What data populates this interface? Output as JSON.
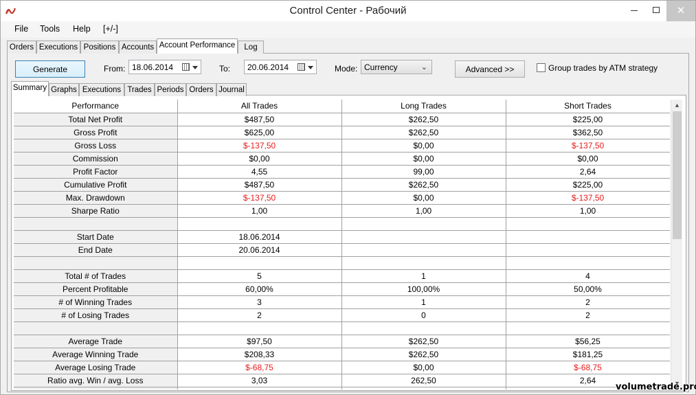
{
  "window": {
    "title": "Control Center - Рабочий",
    "close_glyph": "✕",
    "accent_close": "#c7c7c7"
  },
  "menu": [
    "File",
    "Tools",
    "Help",
    "[+/-]"
  ],
  "top_tabs": [
    "Orders",
    "Executions",
    "Positions",
    "Accounts",
    "Account Performance",
    "Log"
  ],
  "top_tabs_active": "Account Performance",
  "toolbar": {
    "generate_label": "Generate",
    "from_label": "From:",
    "from_value": "18.06.2014",
    "to_label": "To:",
    "to_value": "20.06.2014",
    "mode_label": "Mode:",
    "mode_value": "Currency",
    "advanced_label": "Advanced >>",
    "group_label": "Group trades by ATM strategy",
    "group_checked": false
  },
  "inner_tabs": [
    "Summary",
    "Graphs",
    "Executions",
    "Trades",
    "Periods",
    "Orders",
    "Journal"
  ],
  "inner_tabs_active": "Summary",
  "table": {
    "headers": [
      "Performance",
      "All Trades",
      "Long Trades",
      "Short Trades"
    ],
    "rows": [
      {
        "label": "Total Net Profit",
        "all": "$487,50",
        "long": "$262,50",
        "short": "$225,00"
      },
      {
        "label": "Gross Profit",
        "all": "$625,00",
        "long": "$262,50",
        "short": "$362,50"
      },
      {
        "label": "Gross Loss",
        "all": "$-137,50",
        "long": "$0,00",
        "short": "$-137,50"
      },
      {
        "label": "Commission",
        "all": "$0,00",
        "long": "$0,00",
        "short": "$0,00"
      },
      {
        "label": "Profit Factor",
        "all": "4,55",
        "long": "99,00",
        "short": "2,64"
      },
      {
        "label": "Cumulative Profit",
        "all": "$487,50",
        "long": "$262,50",
        "short": "$225,00"
      },
      {
        "label": "Max. Drawdown",
        "all": "$-137,50",
        "long": "$0,00",
        "short": "$-137,50"
      },
      {
        "label": "Sharpe Ratio",
        "all": "1,00",
        "long": "1,00",
        "short": "1,00"
      },
      {
        "label": "",
        "all": "",
        "long": "",
        "short": ""
      },
      {
        "label": "Start Date",
        "all": "18.06.2014",
        "long": "",
        "short": ""
      },
      {
        "label": "End Date",
        "all": "20.06.2014",
        "long": "",
        "short": ""
      },
      {
        "label": "",
        "all": "",
        "long": "",
        "short": ""
      },
      {
        "label": "Total # of Trades",
        "all": "5",
        "long": "1",
        "short": "4"
      },
      {
        "label": "Percent Profitable",
        "all": "60,00%",
        "long": "100,00%",
        "short": "50,00%"
      },
      {
        "label": "# of Winning Trades",
        "all": "3",
        "long": "1",
        "short": "2"
      },
      {
        "label": "# of Losing Trades",
        "all": "2",
        "long": "0",
        "short": "2"
      },
      {
        "label": "",
        "all": "",
        "long": "",
        "short": ""
      },
      {
        "label": "Average Trade",
        "all": "$97,50",
        "long": "$262,50",
        "short": "$56,25"
      },
      {
        "label": "Average Winning Trade",
        "all": "$208,33",
        "long": "$262,50",
        "short": "$181,25"
      },
      {
        "label": "Average Losing Trade",
        "all": "$-68,75",
        "long": "$0,00",
        "short": "$-68,75"
      },
      {
        "label": "Ratio avg. Win / avg. Loss",
        "all": "3,03",
        "long": "262,50",
        "short": "2,64"
      },
      {
        "label": "",
        "all": "",
        "long": "",
        "short": ""
      }
    ],
    "negative_color": "#e81a1a"
  },
  "watermark": "volumetrade.pro"
}
